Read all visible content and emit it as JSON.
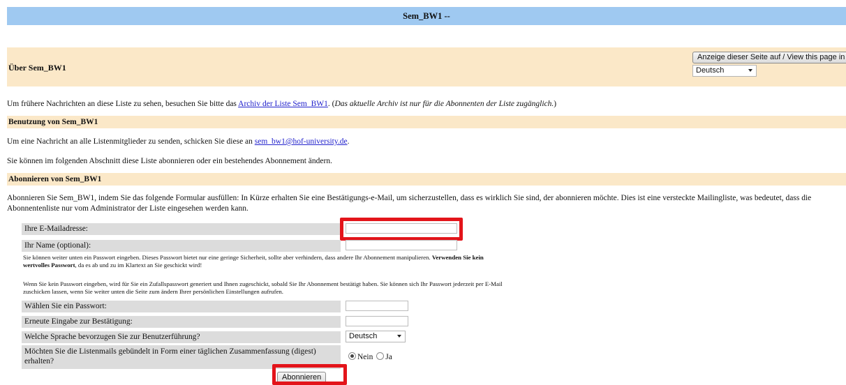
{
  "header": {
    "title": "Sem_BW1 --"
  },
  "about": {
    "title": "Über Sem_BW1",
    "view_button": "Anzeige dieser Seite auf / View this page in",
    "language_selected": "Deutsch"
  },
  "archive": {
    "text_before": "Um frühere Nachrichten an diese Liste zu sehen, besuchen Sie bitte das ",
    "link": "Archiv der Liste Sem_BW1",
    "text_after": ". (",
    "italic": "Das aktuelle Archiv ist nur für die Abonnenten der Liste zugänglich.",
    "close": ")"
  },
  "usage": {
    "title": "Benutzung von Sem_BW1",
    "send_before": "Um eine Nachricht an alle Listenmitglieder zu senden, schicken Sie diese an ",
    "send_link": "sem_bw1@hof-university.de",
    "send_after": ".",
    "section_text": "Sie können im folgenden Abschnitt diese Liste abonnieren oder ein bestehendes Abonnement ändern."
  },
  "subscribe": {
    "title": "Abonnieren von Sem_BW1",
    "intro_line1": "Abonnieren Sie Sem_BW1, indem Sie das folgende Formular ausfüllen: In Kürze erhalten Sie eine Bestätigungs-e-Mail, um sicherzustellen, dass es wirklich Sie sind, der abonnieren möchte. Dies ist eine versteckte Mailingliste, was bedeutet, dass die",
    "intro_line2": "Abonnentenliste nur vom Administrator der Liste eingesehen werden kann.",
    "email_label": "Ihre E-Mailadresse:",
    "name_label": "Ihr Name (optional):",
    "pw_note1_a": "Sie können weiter unten ein Passwort eingeben. Dieses Passwort bietet nur eine geringe Sicherheit, sollte aber verhindern, dass andere Ihr Abonnement manipulieren. ",
    "pw_note1_bold_a": "Verwenden Sie kein",
    "pw_note1_bold_b": "wertvolles Passwort",
    "pw_note1_b": ", da es ab und zu im Klartext an Sie geschickt wird!",
    "pw_note2_line1": "Wenn Sie kein Passwort eingeben, wird für Sie ein Zufallspasswort generiert und Ihnen zugeschickt, sobald Sie Ihr Abonnement bestätigt haben. Sie können sich Ihr Passwort jederzeit per E-Mail",
    "pw_note2_line2": "zuschicken lassen, wenn Sie weiter unten die Seite zum ändern Ihrer persönlichen Einstellungen aufrufen.",
    "pw_label": "Wählen Sie ein Passwort:",
    "pw_confirm_label": "Erneute Eingabe zur Bestätigung:",
    "lang_label": "Welche Sprache bevorzugen Sie zur Benutzerführung?",
    "lang_value": "Deutsch",
    "digest_line1": "Möchten Sie die Listenmails gebündelt in Form einer täglichen Zusammenfassung (digest)",
    "digest_line2": "erhalten?",
    "digest_no": "Nein",
    "digest_yes": "Ja",
    "submit": "Abonnieren"
  },
  "colors": {
    "title_bar": "#9fc9f1",
    "section_band": "#fbe8c8",
    "highlight": "#e3141a",
    "link": "#2222cc"
  }
}
